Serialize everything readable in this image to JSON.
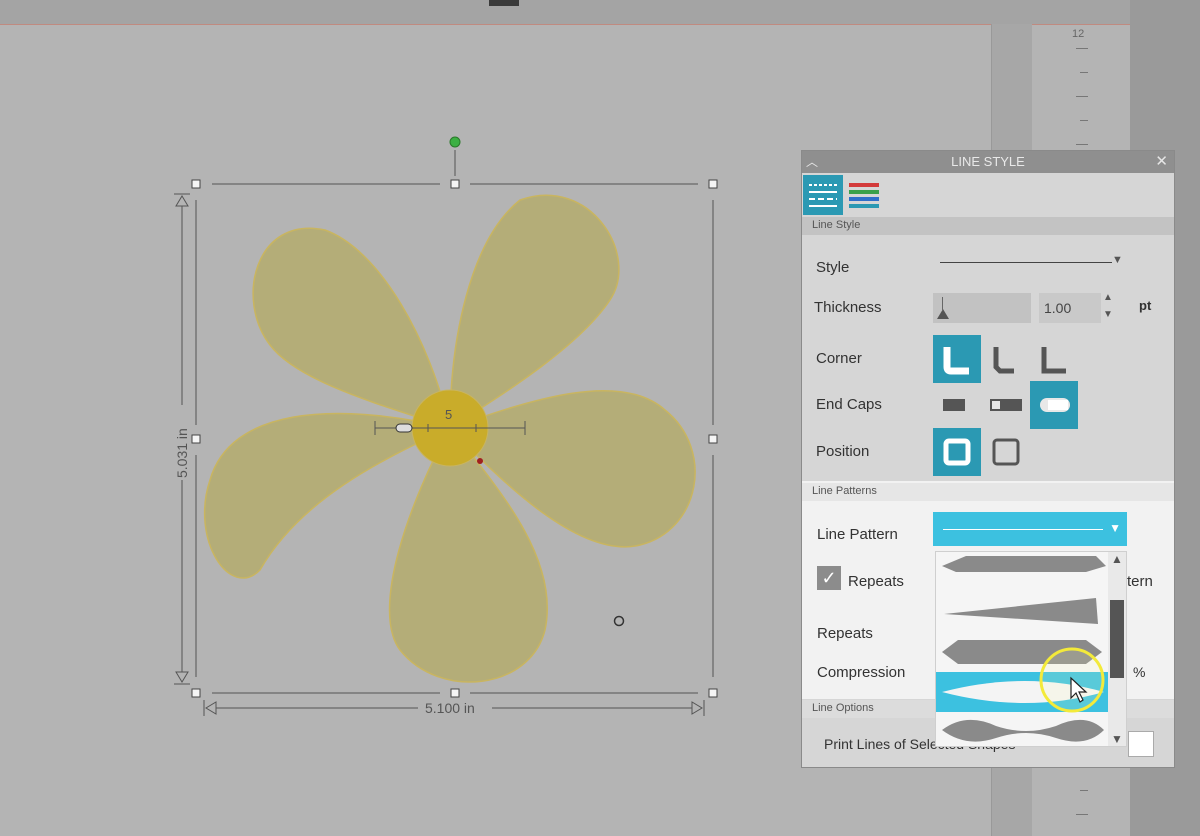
{
  "workspace": {
    "ruler_tick_label": "12",
    "width_label": "5.100 in",
    "height_label": "5.031 in",
    "center_label": "5"
  },
  "panel": {
    "title": "LINE STYLE",
    "collapse_icon": "chevron-up-icon",
    "close_icon": "close-icon",
    "tabs": [
      {
        "name": "line-style-tab",
        "icon": "line-style-icon",
        "selected": true
      },
      {
        "name": "line-color-tab",
        "icon": "line-color-icon",
        "selected": false
      }
    ],
    "sections": {
      "line_style": "Line Style",
      "line_patterns": "Line Patterns",
      "line_options": "Line Options"
    },
    "style_label": "Style",
    "thickness_label": "Thickness",
    "thickness_value": "1.00",
    "thickness_unit": "pt",
    "corner_label": "Corner",
    "end_caps_label": "End Caps",
    "position_label": "Position",
    "line_pattern_label": "Line Pattern",
    "repeats_checkbox_label": "Repeats",
    "repeats_checked": true,
    "repeats_label": "Repeats",
    "compression_label": "Compression",
    "compression_unit": "%",
    "partial_text_right": "tern",
    "print_lines_label": "Print Lines of Selected Shapes"
  },
  "colors": {
    "accent": "#2b99b3",
    "dropdown": "#3cc1e0",
    "petal_fill": "#b4ad78",
    "center_fill": "#c9ac2a",
    "rotate_handle": "#3cb043"
  }
}
